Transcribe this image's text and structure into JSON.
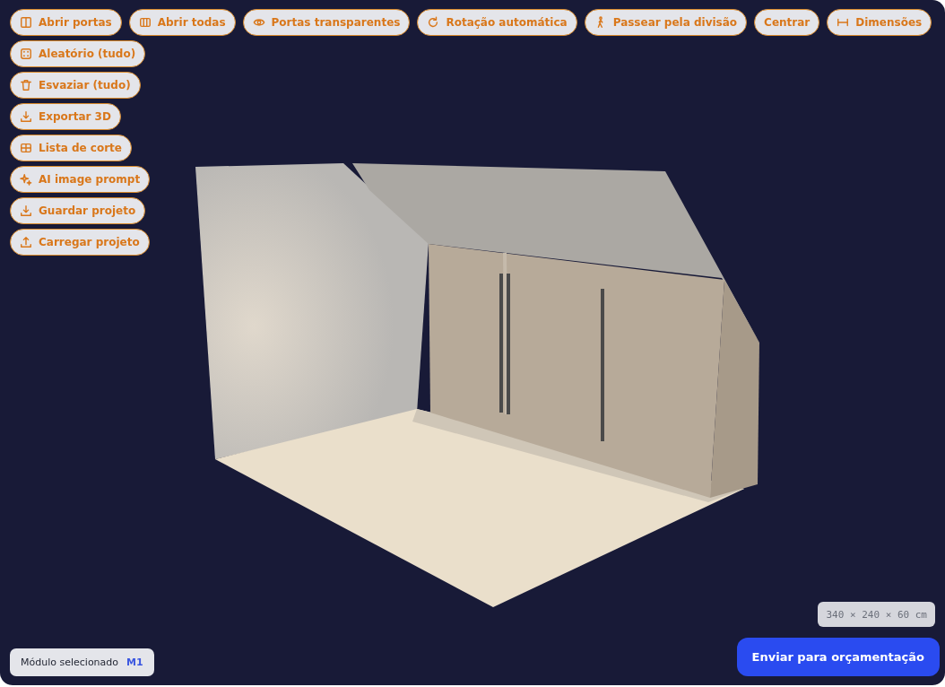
{
  "toolbar": [
    {
      "label": "Abrir portas"
    },
    {
      "label": "Abrir todas"
    },
    {
      "label": "Portas transparentes"
    },
    {
      "label": "Rotação automática"
    },
    {
      "label": "Passear pela divisão"
    },
    {
      "label": "Centrar"
    },
    {
      "label": "Dimensões"
    }
  ],
  "side_actions": [
    {
      "label": "Aleatório (tudo)"
    },
    {
      "label": "Esvaziar (tudo)"
    },
    {
      "label": "Exportar 3D"
    },
    {
      "label": "Lista de corte"
    },
    {
      "label": "AI image prompt"
    },
    {
      "label": "Guardar projeto"
    },
    {
      "label": "Carregar projeto"
    }
  ],
  "dimensions": "340 × 240 × 60 cm",
  "selected_module": {
    "label": "Módulo selecionado",
    "value": "M1"
  },
  "submit_button": "Enviar para orçamentação"
}
